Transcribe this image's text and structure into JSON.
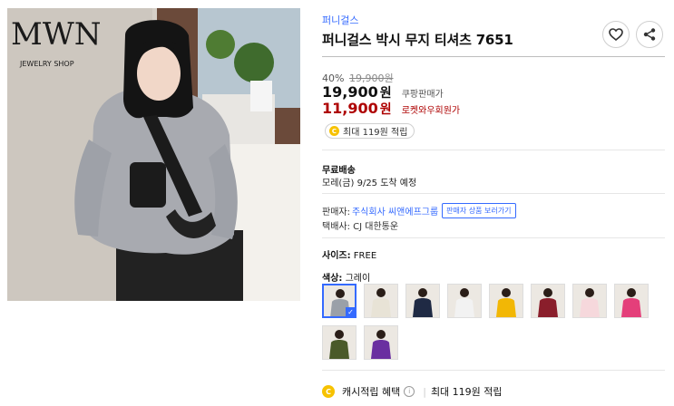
{
  "product": {
    "brand": "퍼니걸스",
    "title": "퍼니걸스 박시 무지 티셔츠 7651"
  },
  "photo": {
    "sign_text": "MWN",
    "sign_sub": "JEWELRY SHOP"
  },
  "price": {
    "discount": "40%",
    "original": "19,900원",
    "sale_value": "19,900",
    "sale_unit": "원",
    "sale_label": "쿠팡판매가",
    "member_value": "11,900",
    "member_unit": "원",
    "member_label": "로켓와우회원가",
    "reward_text": "최대 119원 적립"
  },
  "shipping": {
    "title": "무료배송",
    "date": "모레(금) 9/25 도착 예정"
  },
  "seller": {
    "label": "판매자:",
    "name": "주식회사 씨앤에프그룹",
    "button": "판매자 상품 보러가기",
    "courier": "택배사: CJ 대한통운"
  },
  "options": {
    "size_label": "사이즈:",
    "size_value": "FREE",
    "color_label": "색상:",
    "color_value": "그레이",
    "swatches": [
      "#9aa0a8",
      "#e8e3d6",
      "#1f2a44",
      "#f2f2f2",
      "#f2b705",
      "#8a1e2b",
      "#f6d8dc",
      "#e43f7a",
      "#4a5a2a",
      "#6a2fa0"
    ]
  },
  "cash": {
    "coin": "C",
    "label": "캐시적립 혜택",
    "info": "i",
    "text": "최대 119원 적립"
  },
  "colors": {
    "accent": "#346aff",
    "member_red": "#ae0000",
    "coin_yellow": "#f7c200"
  }
}
